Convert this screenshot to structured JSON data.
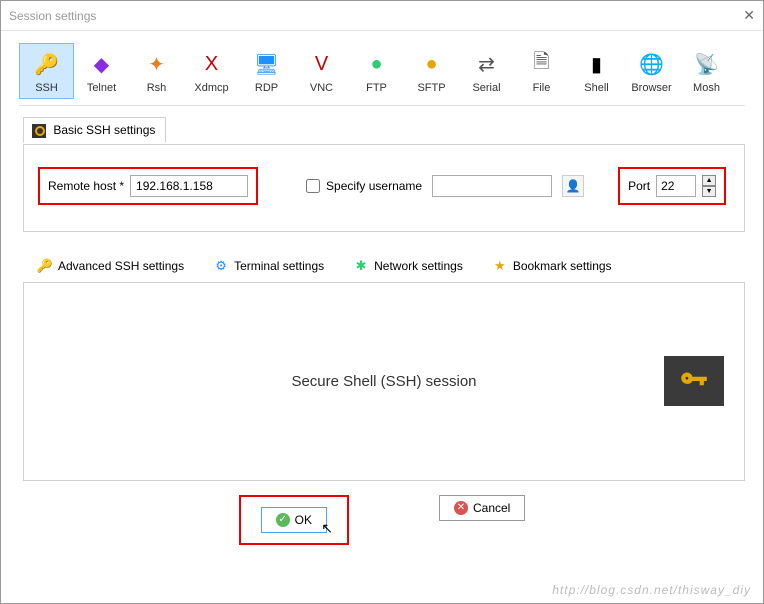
{
  "window": {
    "title": "Session settings"
  },
  "session_types": [
    {
      "label": "SSH",
      "icon": "🔑",
      "color": "#e6a800"
    },
    {
      "label": "Telnet",
      "icon": "◆",
      "color": "#8a2be2"
    },
    {
      "label": "Rsh",
      "icon": "✦",
      "color": "#e67e22"
    },
    {
      "label": "Xdmcp",
      "icon": "X",
      "color": "#cc0000"
    },
    {
      "label": "RDP",
      "icon": "🖥",
      "color": "#1e90ff"
    },
    {
      "label": "VNC",
      "icon": "V",
      "color": "#cc0000"
    },
    {
      "label": "FTP",
      "icon": "●",
      "color": "#2ecc71"
    },
    {
      "label": "SFTP",
      "icon": "●",
      "color": "#e6a800"
    },
    {
      "label": "Serial",
      "icon": "⇄",
      "color": "#555"
    },
    {
      "label": "File",
      "icon": "🗎",
      "color": "#555"
    },
    {
      "label": "Shell",
      "icon": "▮",
      "color": "#000"
    },
    {
      "label": "Browser",
      "icon": "🌐",
      "color": "#1e90ff"
    },
    {
      "label": "Mosh",
      "icon": "📡",
      "color": "#888"
    }
  ],
  "basic_tab": {
    "label": "Basic SSH settings"
  },
  "fields": {
    "remote_host_label": "Remote host *",
    "remote_host_value": "192.168.1.158",
    "specify_username_label": "Specify username",
    "specify_username_checked": false,
    "username_value": "",
    "port_label": "Port",
    "port_value": "22"
  },
  "sub_tabs": [
    {
      "label": "Advanced SSH settings",
      "icon": "🔑",
      "color": "#e6a800"
    },
    {
      "label": "Terminal settings",
      "icon": "⚙",
      "color": "#1e90ff"
    },
    {
      "label": "Network settings",
      "icon": "✱",
      "color": "#2ecc71"
    },
    {
      "label": "Bookmark settings",
      "icon": "★",
      "color": "#e6a800"
    }
  ],
  "content": {
    "title": "Secure Shell (SSH) session"
  },
  "buttons": {
    "ok": "OK",
    "cancel": "Cancel"
  },
  "watermark": "http://blog.csdn.net/thisway_diy"
}
